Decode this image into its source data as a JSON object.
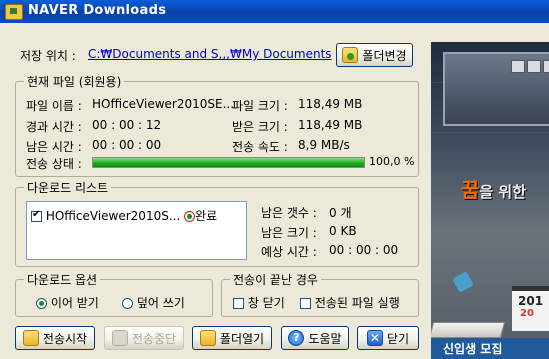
{
  "window": {
    "title": "NAVER Downloads"
  },
  "save_location": {
    "label": "저장 위치 :",
    "path": "C:₩Documents and S,,,₩My Documents",
    "change_button": "폴더변경"
  },
  "current_file": {
    "legend": "현재 파일 (회원용)",
    "file_name_label": "파일 이름 :",
    "file_name_value": "HOfficeViewer2010SE...",
    "file_size_label": "파일 크기 :",
    "file_size_value": "118,49 MB",
    "elapsed_label": "경과 시간 :",
    "elapsed_value": "00 : 00 : 12",
    "received_label": "받은 크기 :",
    "received_value": "118,49 MB",
    "remaining_label": "남은 시간 :",
    "remaining_value": "00 : 00 : 00",
    "speed_label": "전송 속도 :",
    "speed_value": "8,9 MB/s",
    "status_label": "전송 상태 :",
    "progress_percent": 100,
    "progress_text": "100,0 %"
  },
  "download_list": {
    "legend": "다운로드 리스트",
    "items": [
      {
        "name": "HOfficeViewer2010S...",
        "checked": true,
        "status": "완료"
      }
    ],
    "remaining_count_label": "남은 갯수 :",
    "remaining_count_value": "0 개",
    "remaining_size_label": "남은 크기 :",
    "remaining_size_value": "0 KB",
    "expected_time_label": "예상 시간 :",
    "expected_time_value": "00 : 00 : 00"
  },
  "download_options": {
    "legend": "다운로드 옵션",
    "resume_label": "이어 받기",
    "overwrite_label": "덮어 쓰기",
    "selected": "resume"
  },
  "on_complete": {
    "legend": "전송이 끝난 경우",
    "close_window_label": "창 닫기",
    "run_file_label": "전송된 파일 실행",
    "close_window_checked": false,
    "run_file_checked": false
  },
  "buttons": {
    "start": "전송시작",
    "stop": "전송중단",
    "open_folder": "폴더열기",
    "help": "도움말",
    "close": "닫기"
  },
  "ad": {
    "headline_char": "꿈",
    "headline_rest": "을 위한",
    "calendar_year": "201",
    "calendar_sub": "20",
    "banner": "신입생 모집"
  },
  "colors": {
    "title_bar": "#0842a8",
    "progress_fill": "#1aab1a",
    "link": "#0000cc",
    "ad_accent": "#ff6a00"
  }
}
